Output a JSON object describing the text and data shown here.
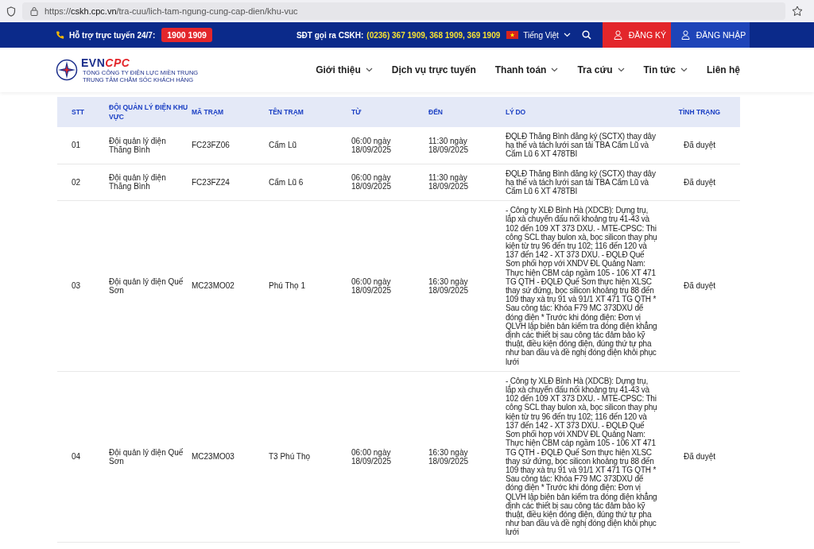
{
  "browser": {
    "url_host": "cskh.cpc.vn",
    "url_prefix": "https://",
    "url_path": "/tra-cuu/lich-tam-ngung-cung-cap-dien/khu-vuc"
  },
  "topbar": {
    "hotline_label": "Hỗ trợ trực tuyến 24/7:",
    "hotline_number": "1900 1909",
    "cskh_label": "SĐT gọi ra CSKH:",
    "cskh_numbers": "(0236) 367 1909, 368 1909, 369 1909",
    "language": "Tiếng Việt",
    "register": "ĐĂNG KÝ",
    "login": "ĐĂNG NHẬP"
  },
  "header": {
    "brand_prefix": "EVN",
    "brand_suffix": "CPC",
    "company": "TỔNG CÔNG TY ĐIỆN LỰC MIỀN TRUNG",
    "center": "TRUNG TÂM CHĂM SÓC KHÁCH HÀNG",
    "menu": [
      {
        "label": "Giới thiệu",
        "dropdown": true
      },
      {
        "label": "Dịch vụ trực tuyến",
        "dropdown": false
      },
      {
        "label": "Thanh toán",
        "dropdown": true
      },
      {
        "label": "Tra cứu",
        "dropdown": true
      },
      {
        "label": "Tin tức",
        "dropdown": true
      },
      {
        "label": "Liên hệ",
        "dropdown": false
      }
    ]
  },
  "table": {
    "columns": [
      "STT",
      "ĐỘI QUẢN LÝ ĐIỆN KHU VỰC",
      "MÃ TRẠM",
      "TÊN TRẠM",
      "TỪ",
      "ĐẾN",
      "LÝ DO",
      "TÌNH TRẠNG"
    ],
    "rows": [
      [
        "01",
        "Đội quản lý điện Thăng Bình",
        "FC23FZ06",
        "Cẩm Lũ",
        "06:00 ngày 18/09/2025",
        "11:30 ngày 18/09/2025",
        "ĐQLĐ Thăng Bình đăng ký (SCTX) thay dây hạ thế và tách lưới san tải TBA Cẩm Lũ và Cẩm Lũ 6 XT 478TBI",
        "Đã duyệt"
      ],
      [
        "02",
        "Đội quản lý điện Thăng Bình",
        "FC23FZ24",
        "Cẩm Lũ 6",
        "06:00 ngày 18/09/2025",
        "11:30 ngày 18/09/2025",
        "ĐQLĐ Thăng Bình đăng ký (SCTX) thay dây hạ thế và tách lưới san tải TBA Cẩm Lũ và Cẩm Lũ 6 XT 478TBI",
        "Đã duyệt"
      ],
      [
        "03",
        "Đội quản lý điện Quế Sơn",
        "MC23MO02",
        "Phú Thọ 1",
        "06:00 ngày 18/09/2025",
        "16:30 ngày 18/09/2025",
        "- Công ty XLĐ Bình Hà (XDCB): Dựng trụ, lắp xà chuyển đấu nối khoảng trụ 41-43 và 102 đến 109 XT 373 DXU. - MTE-CPSC: Thi công SCL thay bulon xà, bọc silicon thay phụ kiện từ trụ 96 đến trụ 102; 116 đến 120 và 137 đến 142 - XT 373 DXU. - ĐQLĐ Quế Sơn phối hợp với XNDV ĐL Quảng Nam: Thực hiện CBM cáp ngầm 105 - 106 XT 471 TG QTH - ĐQLĐ Quế Sơn thực hiện XLSC thay sứ đứng, bọc silicon khoảng trụ 88 đến 109 thay xà trụ 91 và 91/1 XT 471 TG QTH * Sau công tác: Khóa F79 MC 373DXU để đóng điện * Trước khi đóng điện: Đơn vị QLVH lập biên bản kiểm tra đóng điện khẳng định các thiết bị sau công tác đảm bảo kỹ thuật, điều kiện đóng điện, đúng thứ tự pha như ban đầu và đề nghị đóng điện khôi phục lưới",
        "Đã duyệt"
      ],
      [
        "04",
        "Đội quản lý điện Quế Sơn",
        "MC23MO03",
        "T3 Phú Thọ",
        "06:00 ngày 18/09/2025",
        "16:30 ngày 18/09/2025",
        "- Công ty XLĐ Bình Hà (XDCB): Dựng trụ, lắp xà chuyển đấu nối khoảng trụ 41-43 và 102 đến 109 XT 373 DXU. - MTE-CPSC: Thi công SCL thay bulon xà, bọc silicon thay phụ kiện từ trụ 96 đến trụ 102; 116 đến 120 và 137 đến 142 - XT 373 DXU. - ĐQLĐ Quế Sơn phối hợp với XNDV ĐL Quảng Nam: Thực hiện CBM cáp ngầm 105 - 106 XT 471 TG QTH - ĐQLĐ Quế Sơn thực hiện XLSC thay sứ đứng, bọc silicon khoảng trụ 88 đến 109 thay xà trụ 91 và 91/1 XT 471 TG QTH * Sau công tác: Khóa F79 MC 373DXU để đóng điện * Trước khi đóng điện: Đơn vị QLVH lập biên bản kiểm tra đóng điện khẳng định các thiết bị sau công tác đảm bảo kỹ thuật, điều kiện đóng điện, đúng thứ tự pha như ban đầu và đề nghị đóng điện khôi phục lưới",
        "Đã duyệt"
      ]
    ]
  }
}
